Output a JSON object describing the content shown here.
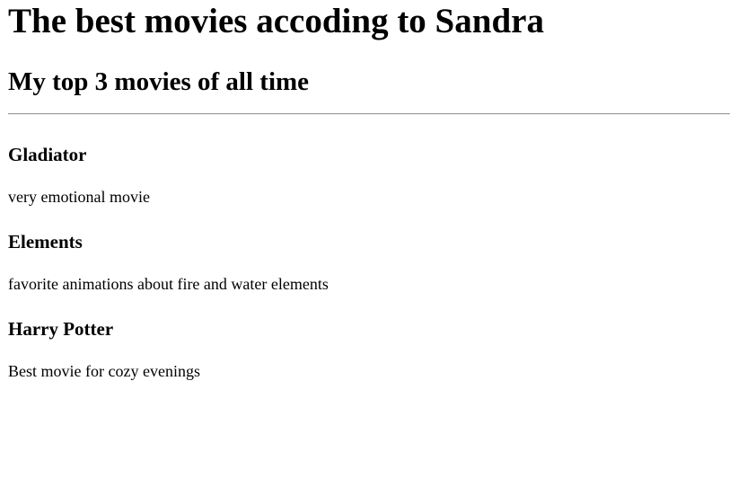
{
  "page": {
    "title": "The best movies accoding to Sandra",
    "subtitle": "My top 3 movies of all time"
  },
  "movies": [
    {
      "title": "Gladiator",
      "description": "very emotional movie"
    },
    {
      "title": "Elements",
      "description": "favorite animations about fire and water elements"
    },
    {
      "title": "Harry Potter",
      "description": "Best movie for cozy evenings"
    }
  ]
}
